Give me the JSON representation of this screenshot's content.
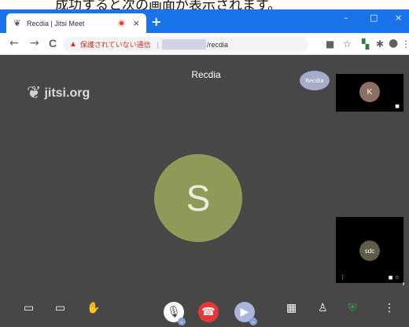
{
  "caption": "成功すると次の画面が表示されます。",
  "browser": {
    "tab_title": "Recdia | Jitsi Meet",
    "tab_close": "×",
    "new_tab": "+",
    "window_controls": [
      "–",
      "□",
      "×"
    ],
    "nav": {
      "back": "←",
      "forward": "→",
      "reload": "C"
    },
    "omnibox": {
      "warning_icon": "warning-triangle-icon",
      "insecure_label": "保護されていない通信",
      "separator": "|",
      "url_suffix": "/recdia"
    }
  },
  "meeting": {
    "logo_text": "jitsi.org",
    "room_name": "Recdia",
    "mini_avatar_text": "Recdia",
    "main_avatar_letter": "S",
    "thumbnails": [
      {
        "avatar": "K"
      },
      {
        "avatar": "sdc"
      }
    ]
  },
  "colors": {
    "tabbar": "#1a73e8",
    "meeting_bg": "#474747",
    "main_avatar": "#8e9a58",
    "hangup": "#e53935",
    "shield": "#34a853"
  }
}
